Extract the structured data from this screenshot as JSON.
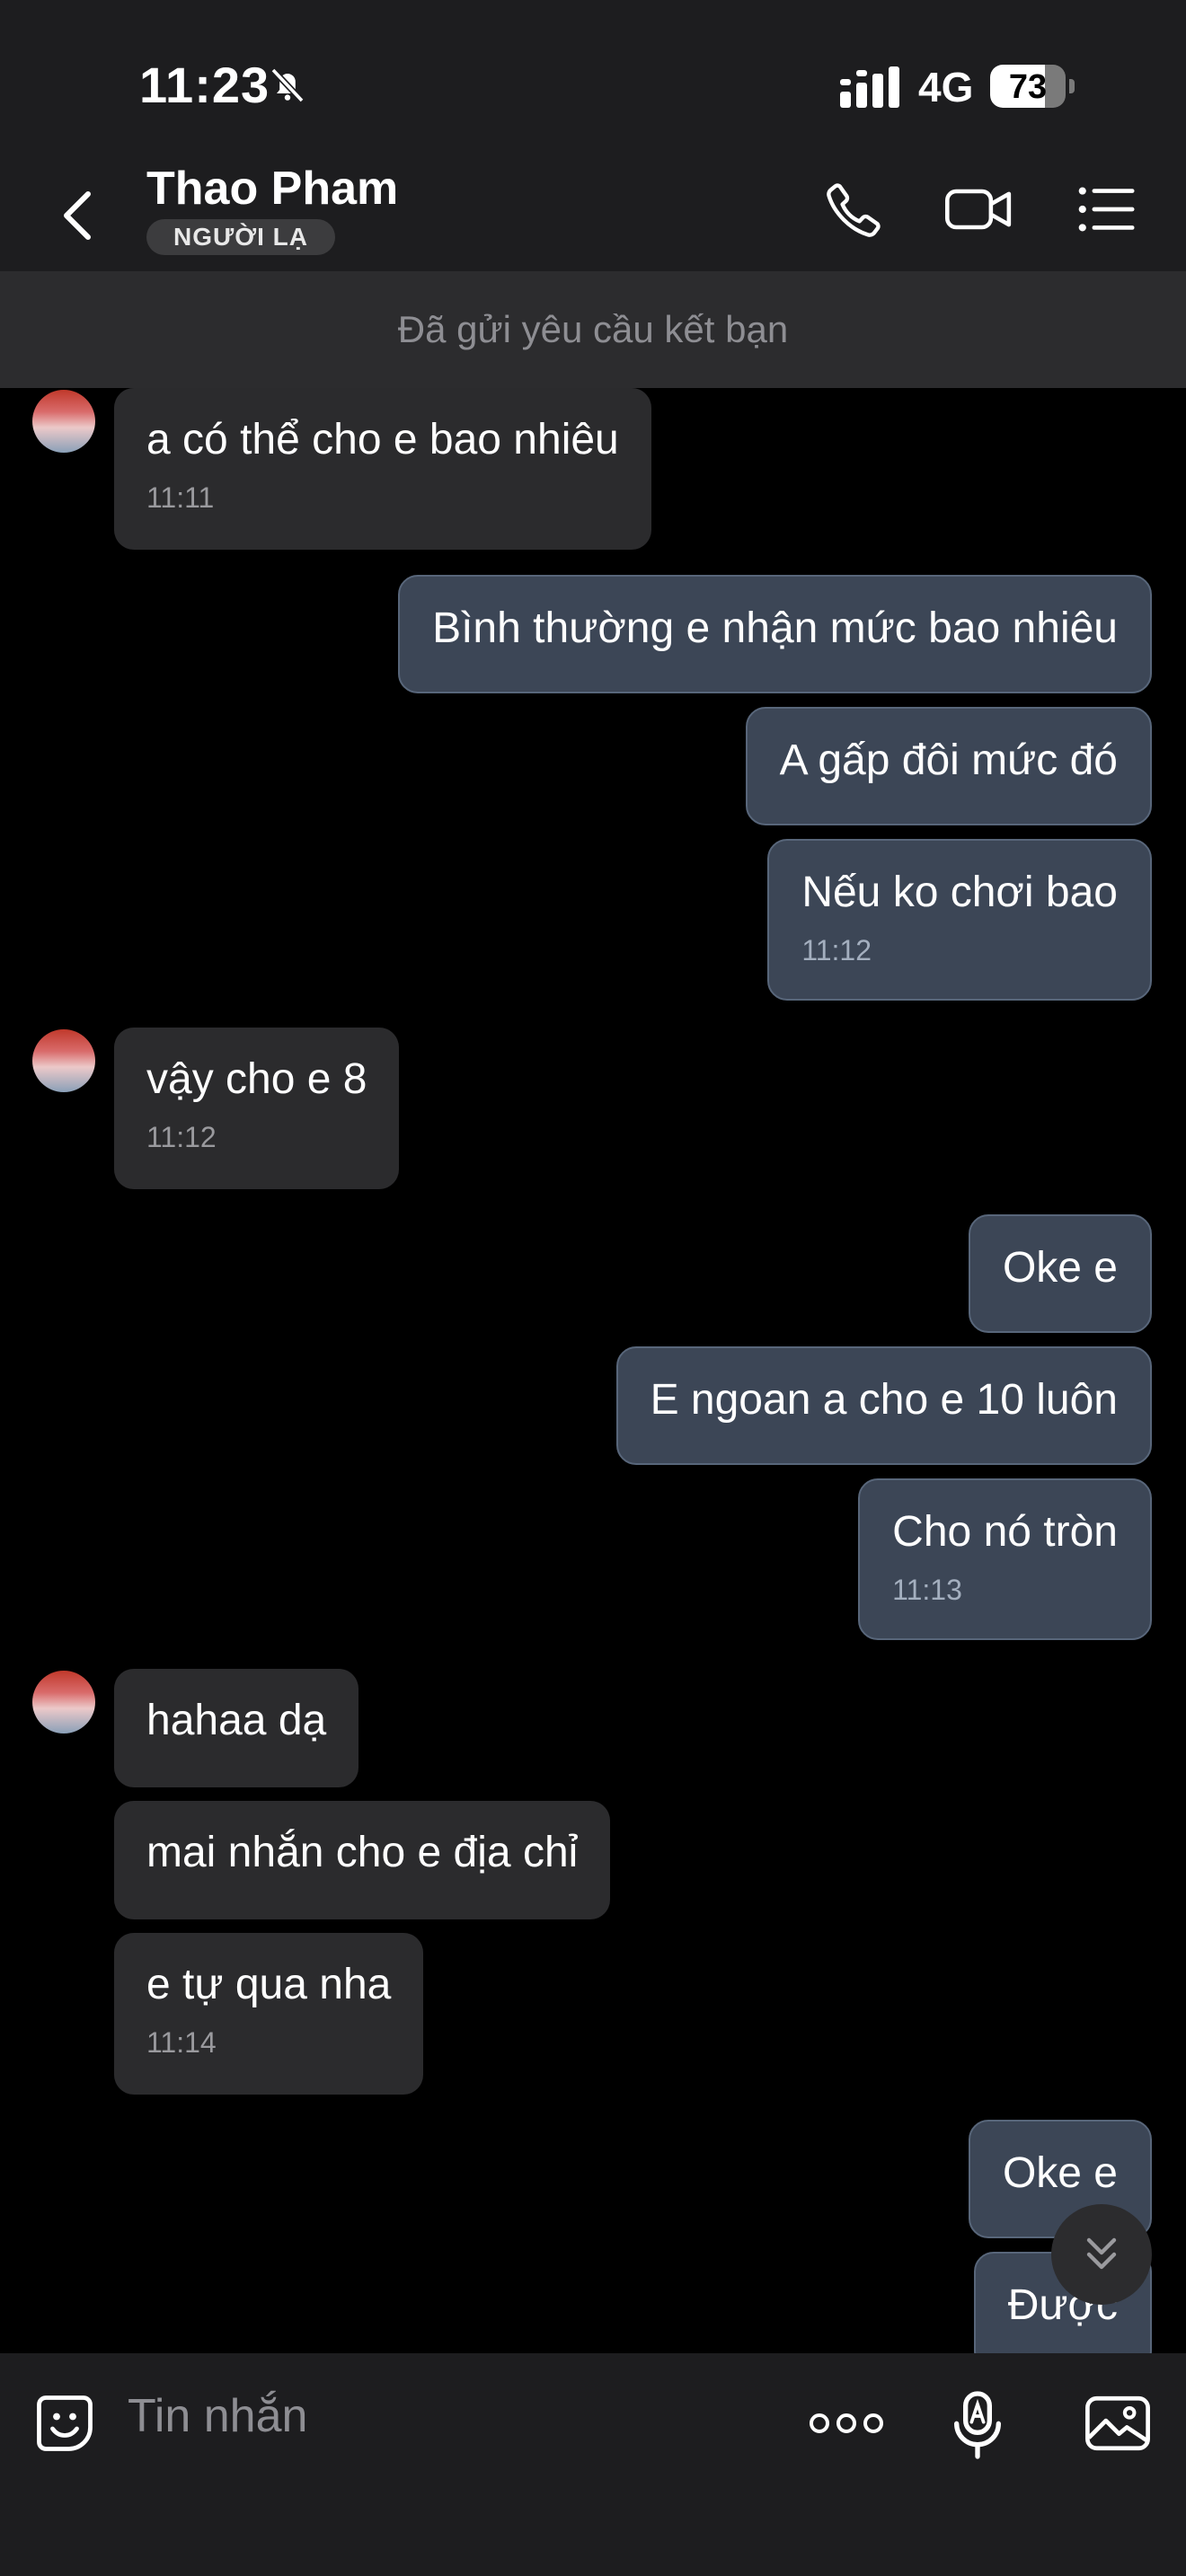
{
  "status_bar": {
    "time": "11:23",
    "network": "4G",
    "battery": "73",
    "battery_level": 0.73
  },
  "header": {
    "contact_name": "Thao Pham",
    "badge": "NGƯỜI LẠ",
    "icons": [
      "back-icon",
      "phone-icon",
      "video-call-icon",
      "menu-list-icon"
    ]
  },
  "banner": {
    "text": "Đã gửi yêu cầu kết bạn"
  },
  "messages": [
    {
      "dir": "in",
      "avatar": true,
      "text": "a có thể cho e bao nhiêu",
      "time": "11:11"
    },
    {
      "dir": "out",
      "text": "Bình thường e nhận mức bao nhiêu",
      "time": ""
    },
    {
      "dir": "out",
      "text": "A gấp đôi mức đó",
      "time": ""
    },
    {
      "dir": "out",
      "text": "Nếu ko chơi bao",
      "time": "11:12"
    },
    {
      "dir": "in",
      "avatar": true,
      "text": "vậy cho e 8",
      "time": "11:12"
    },
    {
      "dir": "out",
      "text": "Oke e",
      "time": ""
    },
    {
      "dir": "out",
      "text": "E ngoan a cho e 10 luôn",
      "time": ""
    },
    {
      "dir": "out",
      "text": "Cho nó tròn",
      "time": "11:13"
    },
    {
      "dir": "in",
      "avatar": true,
      "text": "hahaa dạ",
      "time": ""
    },
    {
      "dir": "in",
      "avatar": false,
      "text": "mai nhắn cho e địa chỉ",
      "time": ""
    },
    {
      "dir": "in",
      "avatar": false,
      "text": "e tự qua nha",
      "time": "11:14"
    },
    {
      "dir": "out",
      "text": "Oke e",
      "time": ""
    },
    {
      "dir": "out",
      "text": "Được",
      "time": ""
    }
  ],
  "composer": {
    "placeholder": "Tin nhắn",
    "icons": [
      "emoji-sticker-icon",
      "more-options-icon",
      "voice-to-text-icon",
      "image-gallery-icon"
    ]
  }
}
